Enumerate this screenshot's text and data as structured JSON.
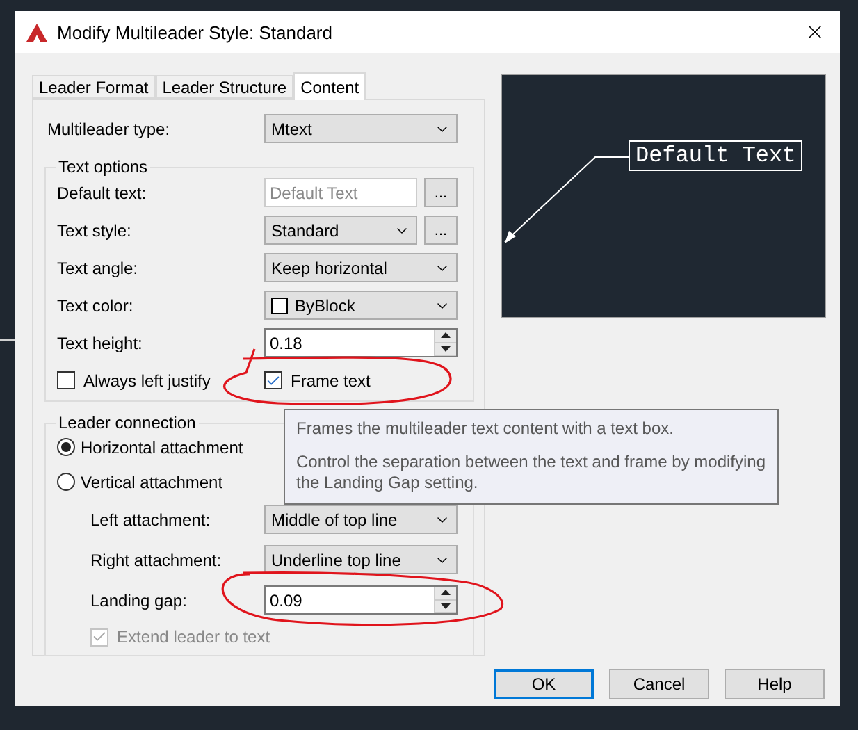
{
  "window": {
    "title": "Modify Multileader Style: Standard"
  },
  "tabs": [
    {
      "label": "Leader Format",
      "selected": false
    },
    {
      "label": "Leader Structure",
      "selected": false
    },
    {
      "label": "Content",
      "selected": true
    }
  ],
  "multileader_type": {
    "label": "Multileader type:",
    "value": "Mtext"
  },
  "text_options": {
    "title": "Text options",
    "fields": [
      {
        "kind": "text",
        "label": "Default text:",
        "value": "Default Text",
        "disabled": true,
        "browse": "..."
      },
      {
        "kind": "combo",
        "label": "Text style:",
        "value": "Standard",
        "browse": "..."
      },
      {
        "kind": "combo",
        "label": "Text angle:",
        "value": "Keep horizontal"
      },
      {
        "kind": "color",
        "label": "Text color:",
        "value": "ByBlock"
      },
      {
        "kind": "spin",
        "label": "Text height:",
        "value": "0.18"
      }
    ],
    "checkboxes": [
      {
        "label": "Always left justify",
        "checked": false
      },
      {
        "label": "Frame text",
        "checked": true
      }
    ]
  },
  "leader_connection": {
    "title": "Leader connection",
    "radios": [
      {
        "label": "Horizontal attachment",
        "selected": true
      },
      {
        "label": "Vertical attachment",
        "selected": false
      }
    ],
    "fields": [
      {
        "kind": "combo",
        "label": "Left attachment:",
        "value": "Middle of top line"
      },
      {
        "kind": "combo",
        "label": "Right attachment:",
        "value": "Underline top line"
      },
      {
        "kind": "spin",
        "label": "Landing gap:",
        "value": "0.09"
      }
    ],
    "extend": {
      "label": "Extend leader to text",
      "checked": true,
      "disabled": true
    }
  },
  "preview": {
    "text": "Default Text"
  },
  "tooltip": {
    "lines": [
      "Frames the multileader text content with a text box.",
      "Control the separation between the text and frame by modifying the Landing Gap setting."
    ]
  },
  "buttons": [
    {
      "label": "OK",
      "default": true
    },
    {
      "label": "Cancel",
      "default": false
    },
    {
      "label": "Help",
      "default": false
    }
  ]
}
